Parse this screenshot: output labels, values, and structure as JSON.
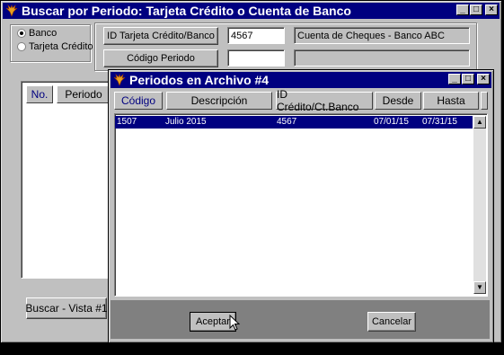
{
  "main_window": {
    "title": "Buscar por Periodo: Tarjeta Crédito o Cuenta de Banco",
    "radio_banco": "Banco",
    "radio_tarjeta": "Tarjeta Crédito",
    "id_button": "ID Tarjeta Crédito/Banco",
    "id_value": "4567",
    "account_description": "Cuenta de Cheques - Banco ABC",
    "codigo_button": "Código Periodo",
    "codigo_value": "",
    "col_no": "No.",
    "col_periodo": "Periodo",
    "search_button": "Buscar - Vista #1"
  },
  "dialog": {
    "title": "Periodos en Archivo #4",
    "columns": [
      "Código",
      "Descripción",
      "ID Crédito/Ct.Banco",
      "Desde",
      "Hasta"
    ],
    "rows": [
      {
        "codigo": "1507",
        "descripcion": "Julio 2015",
        "id": "4567",
        "desde": "07/01/15",
        "hasta": "07/31/15"
      }
    ],
    "accept_button": "Aceptar",
    "cancel_button": "Cancelar"
  },
  "colors": {
    "title_bar": "#000080",
    "face": "#c0c0c0",
    "selection": "#000080"
  },
  "icons": {
    "app": "phoenix-bird-icon"
  }
}
